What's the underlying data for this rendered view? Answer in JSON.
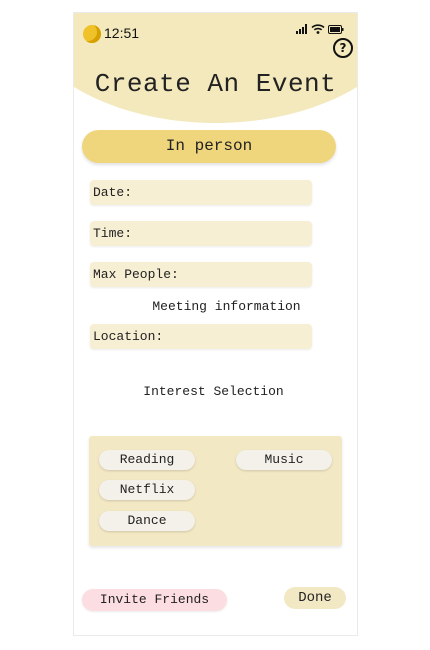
{
  "status_bar": {
    "time": "12:51",
    "icons": [
      "signal-icon",
      "wifi-icon",
      "battery-icon"
    ]
  },
  "header": {
    "title": "Create An Event",
    "help_glyph": "?"
  },
  "mode": {
    "label": "In person"
  },
  "fields": {
    "date_label": "Date:",
    "time_label": "Time:",
    "max_people_label": "Max People:"
  },
  "meeting": {
    "heading": "Meeting information",
    "location_label": "Location:"
  },
  "interests": {
    "heading": "Interest Selection",
    "items": [
      "Reading",
      "Music",
      "Netflix",
      "Dance"
    ]
  },
  "footer": {
    "invite_label": "Invite Friends",
    "done_label": "Done"
  },
  "colors": {
    "header_bg": "#f3e9bd",
    "mode_button": "#efd57c",
    "field_bg": "#f7efd3",
    "invite_button": "#fbdde2",
    "panel_bg": "#f3e8c4"
  }
}
